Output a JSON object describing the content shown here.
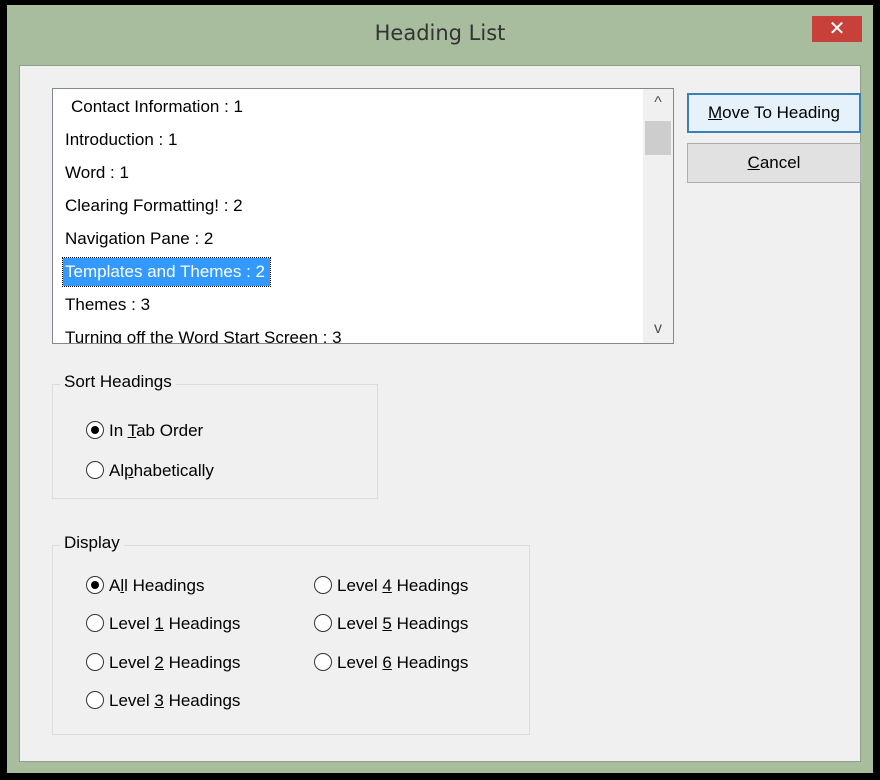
{
  "window": {
    "title": "Heading List",
    "close_glyph": "✕"
  },
  "headings_list": {
    "items": [
      {
        "label": "Contact Information : 1",
        "selected": false,
        "indent": true
      },
      {
        "label": "Introduction : 1",
        "selected": false
      },
      {
        "label": "Word  : 1",
        "selected": false
      },
      {
        "label": "Clearing Formatting! : 2",
        "selected": false
      },
      {
        "label": "Navigation Pane : 2",
        "selected": false
      },
      {
        "label": "Templates and Themes : 2",
        "selected": true
      },
      {
        "label": "Themes : 3",
        "selected": false
      },
      {
        "label": "Turning off the Word Start Screen : 3",
        "selected": false
      }
    ],
    "scroll_up_glyph": "^",
    "scroll_down_glyph": "v"
  },
  "buttons": {
    "move_prefix": "",
    "move_mnemonic": "M",
    "move_rest": "ove To Heading",
    "cancel_mnemonic": "C",
    "cancel_rest": "ancel"
  },
  "sort_headings": {
    "label": "Sort Headings",
    "in_tab_order": {
      "pre": "In ",
      "mn": "T",
      "post": "ab Order",
      "checked": true
    },
    "alphabetically": {
      "pre": "Al",
      "mn": "p",
      "post": "habetically",
      "checked": false
    }
  },
  "display": {
    "label": "Display",
    "all_headings": {
      "pre": "A",
      "mn": "l",
      "post": "l Headings",
      "checked": true
    },
    "level1": {
      "pre": "Level ",
      "mn": "1",
      "post": " Headings",
      "checked": false
    },
    "level2": {
      "pre": "Level ",
      "mn": "2",
      "post": " Headings",
      "checked": false
    },
    "level3": {
      "pre": "Level ",
      "mn": "3",
      "post": " Headings",
      "checked": false
    },
    "level4": {
      "pre": "Level ",
      "mn": "4",
      "post": " Headings",
      "checked": false
    },
    "level5": {
      "pre": "Level ",
      "mn": "5",
      "post": " Headings",
      "checked": false
    },
    "level6": {
      "pre": "Level ",
      "mn": "6",
      "post": " Headings",
      "checked": false
    }
  }
}
